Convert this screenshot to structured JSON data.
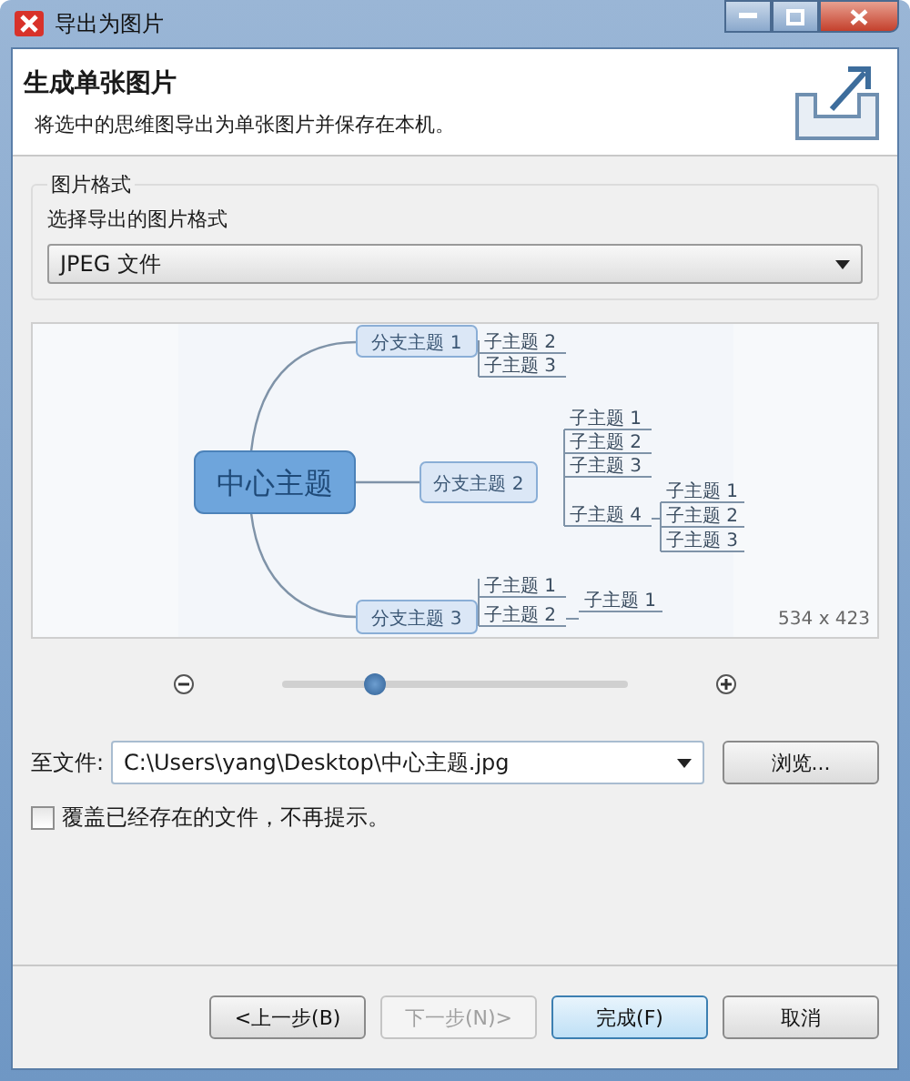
{
  "window": {
    "title": "导出为图片"
  },
  "header": {
    "title": "生成单张图片",
    "description": "将选中的思维图导出为单张图片并保存在本机。"
  },
  "format_group": {
    "title": "图片格式",
    "label": "选择导出的图片格式",
    "value": "JPEG 文件"
  },
  "preview": {
    "central": "中心主题",
    "size": "534 x 423",
    "branches": [
      {
        "label": "分支主题 1",
        "children": [
          {
            "label": "子主题 2"
          },
          {
            "label": "子主题 3"
          }
        ]
      },
      {
        "label": "分支主题 2",
        "children": [
          {
            "label": "子主题 1"
          },
          {
            "label": "子主题 2"
          },
          {
            "label": "子主题 3"
          },
          {
            "label": "子主题 4",
            "children": [
              {
                "label": "子主题 1"
              },
              {
                "label": "子主题 2"
              },
              {
                "label": "子主题 3"
              }
            ]
          }
        ]
      },
      {
        "label": "分支主题 3",
        "children": [
          {
            "label": "子主题 1"
          },
          {
            "label": "子主题 2",
            "children": [
              {
                "label": "子主题 1"
              }
            ]
          }
        ]
      }
    ]
  },
  "zoom": {
    "level": 0.27
  },
  "file": {
    "label": "至文件:",
    "value": "C:\\Users\\yang\\Desktop\\中心主题.jpg",
    "browse": "浏览..."
  },
  "overwrite": {
    "label": "覆盖已经存在的文件，不再提示。",
    "checked": false
  },
  "buttons": [
    {
      "label": "<上一步(B)",
      "disabled": false,
      "default": false
    },
    {
      "label": "下一步(N)>",
      "disabled": true,
      "default": false
    },
    {
      "label": "完成(F)",
      "disabled": false,
      "default": true
    },
    {
      "label": "取消",
      "disabled": false,
      "default": false
    }
  ]
}
